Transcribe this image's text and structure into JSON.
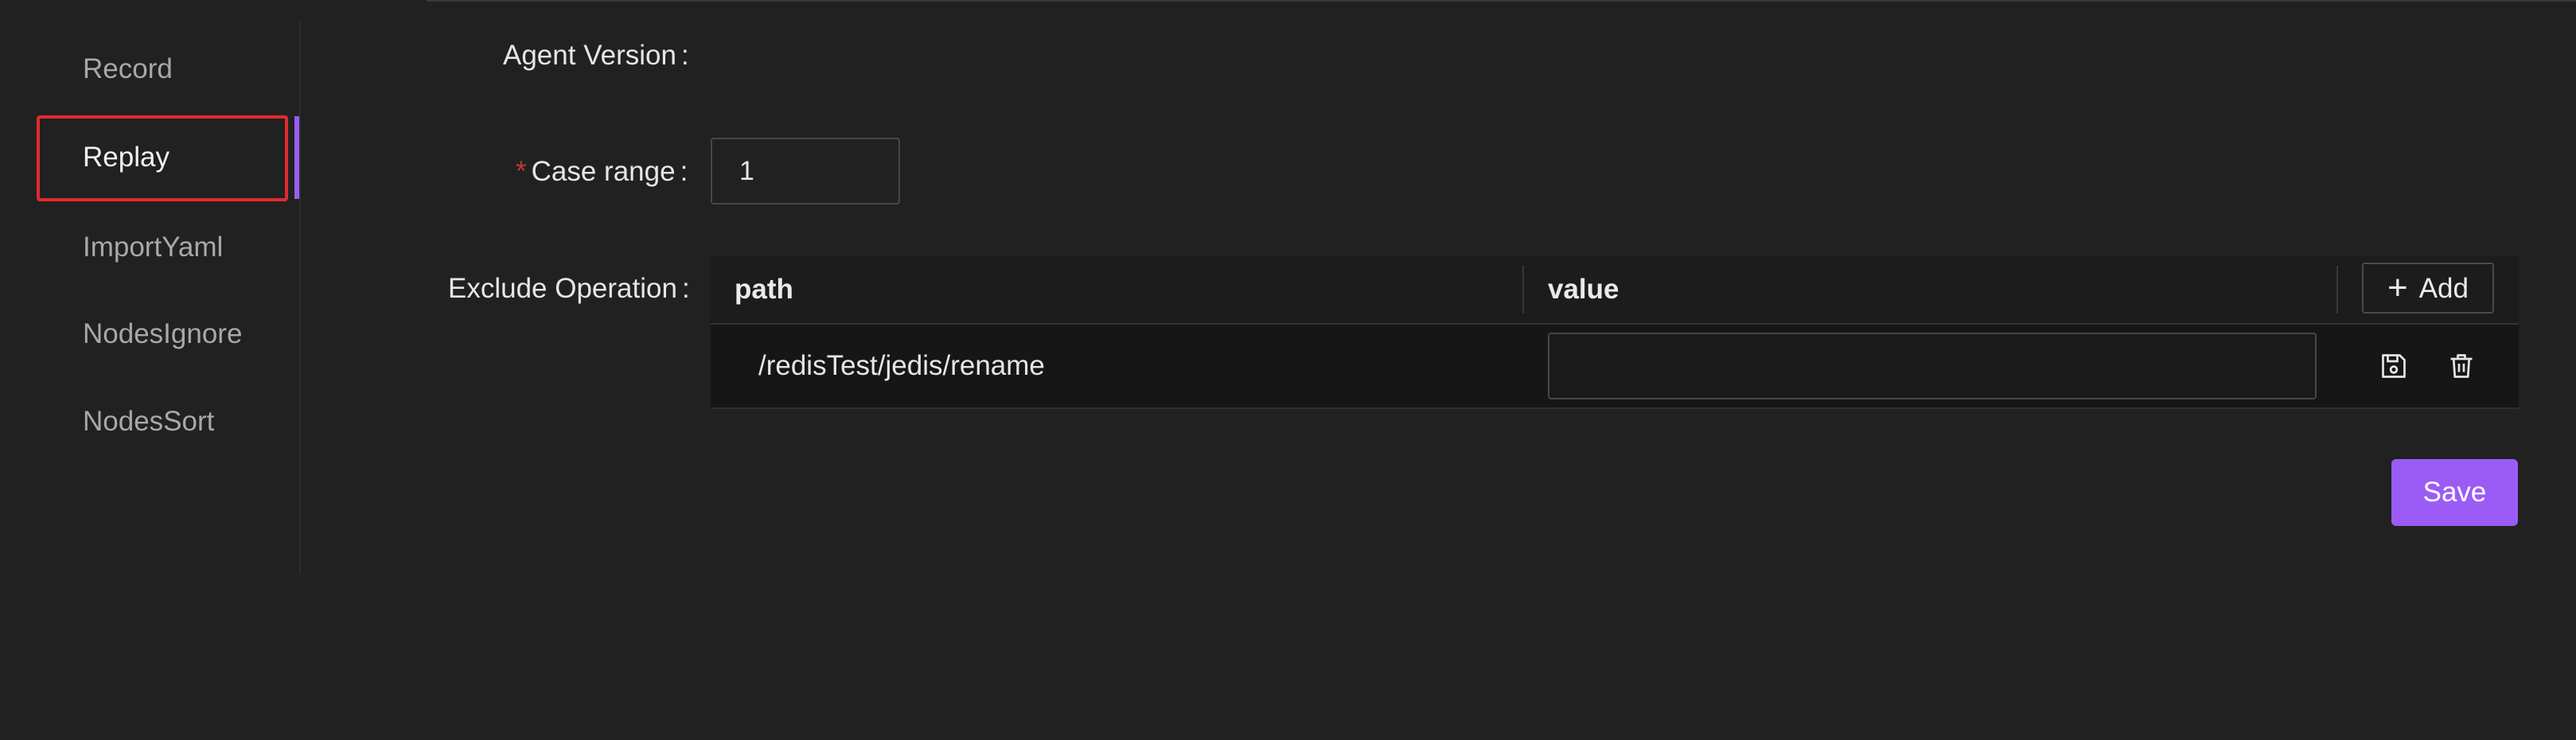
{
  "sidebar": {
    "items": [
      {
        "label": "Record",
        "active": false
      },
      {
        "label": "Replay",
        "active": true
      },
      {
        "label": "ImportYaml",
        "active": false
      },
      {
        "label": "NodesIgnore",
        "active": false
      },
      {
        "label": "NodesSort",
        "active": false
      }
    ]
  },
  "form": {
    "agent_version_label": "Agent Version",
    "agent_version_colon": ":",
    "case_range_required_mark": "*",
    "case_range_label": "Case range",
    "case_range_colon": ":",
    "case_range_value": "1",
    "exclude_operation_label": "Exclude Operation",
    "exclude_operation_colon": ":"
  },
  "table": {
    "columns": [
      "path",
      "value"
    ],
    "add_label": "Add",
    "rows": [
      {
        "path": "/redisTest/jedis/rename",
        "value": ""
      }
    ]
  },
  "actions": {
    "save_label": "Save"
  },
  "icons": {
    "add": "plus-icon",
    "row_save": "save-icon",
    "row_delete": "trash-icon"
  },
  "colors": {
    "accent": "#9b5cf6",
    "highlight": "#e02b2b",
    "background": "#212121"
  }
}
